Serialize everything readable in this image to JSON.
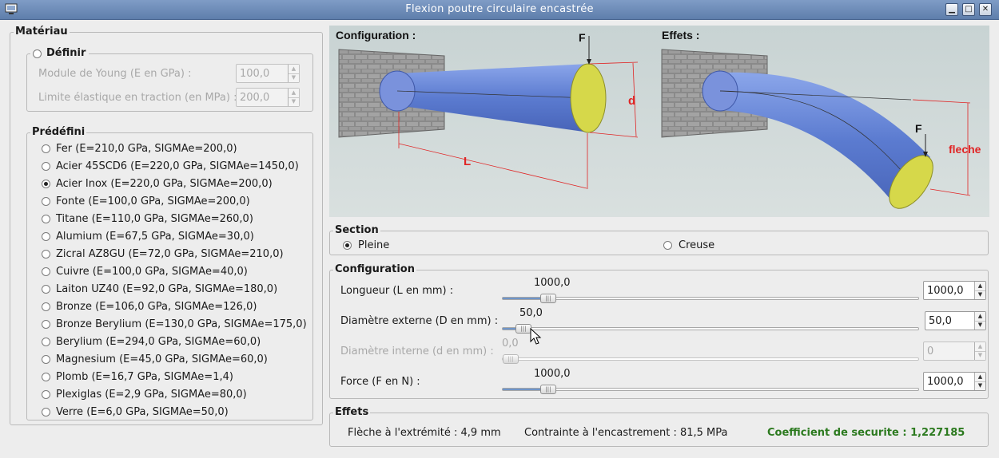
{
  "window": {
    "title": "Flexion poutre circulaire encastrée"
  },
  "materiau": {
    "group_title": "Matériau",
    "definir": {
      "label": "Définir",
      "young_label": "Module de Young (E en GPa) :",
      "young_value": "100,0",
      "limite_label": "Limite élastique en traction (en MPa) :",
      "limite_value": "200,0"
    },
    "predefini": {
      "group_title": "Prédéfini",
      "selected_index": 2,
      "items": [
        "Fer (E=210,0 GPa, SIGMAe=200,0)",
        "Acier 45SCD6 (E=220,0 GPa, SIGMAe=1450,0)",
        "Acier Inox (E=220,0 GPa, SIGMAe=200,0)",
        "Fonte (E=100,0 GPa, SIGMAe=200,0)",
        "Titane (E=110,0 GPa, SIGMAe=260,0)",
        "Alumium (E=67,5 GPa, SIGMAe=30,0)",
        "Zicral AZ8GU (E=72,0 GPa, SIGMAe=210,0)",
        "Cuivre (E=100,0 GPa, SIGMAe=40,0)",
        "Laiton UZ40 (E=92,0 GPa, SIGMAe=180,0)",
        "Bronze (E=106,0 GPa, SIGMAe=126,0)",
        "Bronze Berylium (E=130,0 GPa, SIGMAe=175,0)",
        "Berylium (E=294,0 GPa, SIGMAe=60,0)",
        "Magnesium (E=45,0 GPa, SIGMAe=60,0)",
        "Plomb (E=16,7 GPa, SIGMAe=1,4)",
        "Plexiglas (E=2,9 GPa, SIGMAe=80,0)",
        "Verre (E=6,0 GPa, SIGMAe=50,0)"
      ]
    }
  },
  "illustration": {
    "config_title": "Configuration :",
    "effets_title": "Effets :",
    "label_F": "F",
    "label_d": "d",
    "label_L": "L",
    "label_F2": "F",
    "label_fleche": "fleche"
  },
  "section": {
    "group_title": "Section",
    "pleine": "Pleine",
    "creuse": "Creuse",
    "selected": "Pleine"
  },
  "configuration": {
    "group_title": "Configuration",
    "longueur": {
      "label": "Longueur (L en mm) :",
      "slider_text": "1000,0",
      "spin_value": "1000,0",
      "fraction": 0.11
    },
    "diametre_ext": {
      "label": "Diamètre externe (D en mm) :",
      "slider_text": "50,0",
      "spin_value": "50,0",
      "fraction": 0.05
    },
    "diametre_int": {
      "label": "Diamètre interne (d en mm) :",
      "slider_text": "0,0",
      "spin_value": "0",
      "fraction": 0.0
    },
    "force": {
      "label": "Force (F en N) :",
      "slider_text": "1000,0",
      "spin_value": "1000,0",
      "fraction": 0.11
    }
  },
  "effets": {
    "group_title": "Effets",
    "fleche": "Flèche à l'extrémité : 4,9 mm",
    "contrainte": "Contrainte à l'encastrement  : 81,5 MPa",
    "coefficient": "Coefficient de securite : 1,227185",
    "coefficient_color": "#2c7a1f"
  },
  "colors": {
    "label_red": "#e02424",
    "beam_blue": "#6f8fd6",
    "beam_end_yellow": "#d6d84a",
    "titlebar": "#6d8bb8"
  }
}
